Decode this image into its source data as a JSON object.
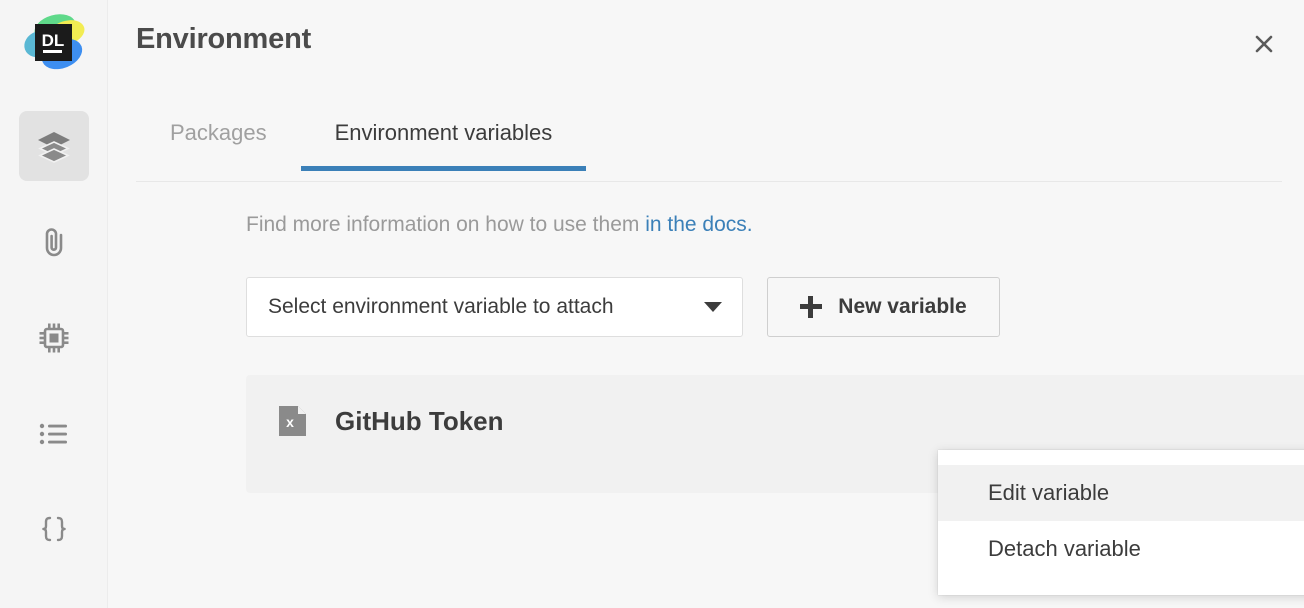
{
  "app": {
    "logo_text": "DL",
    "logo_colors": {
      "green": "#4ad18a",
      "yellow": "#f0e84a",
      "blue": "#3d8ef0",
      "teal": "#5fb7d6",
      "square": "#1b1b1b"
    }
  },
  "sidebar": {
    "items": [
      {
        "name": "environment",
        "icon": "layers-icon",
        "active": true
      },
      {
        "name": "attachments",
        "icon": "paperclip-icon",
        "active": false
      },
      {
        "name": "computation",
        "icon": "cpu-chip-icon",
        "active": false
      },
      {
        "name": "outline",
        "icon": "bulleted-list-icon",
        "active": false
      },
      {
        "name": "variables",
        "icon": "curly-braces-icon",
        "active": false
      }
    ]
  },
  "header": {
    "title": "Environment",
    "close_icon": "close-icon"
  },
  "tabs": [
    {
      "label": "Packages",
      "active": false
    },
    {
      "label": "Environment variables",
      "active": true
    }
  ],
  "docs": {
    "text": "Find more information on how to use them",
    "link_text": "in the docs."
  },
  "controls": {
    "select_label": "Select environment variable to attach",
    "select_icon": "chevron-down-icon",
    "new_variable_label": "New variable",
    "new_variable_icon": "plus-icon"
  },
  "variables": [
    {
      "name": "GitHub Token",
      "icon": "file-x-icon",
      "menu_icon": "ellipsis-icon"
    }
  ],
  "context_menu": {
    "items": [
      {
        "label": "Edit variable",
        "highlighted": true
      },
      {
        "label": "Detach variable",
        "highlighted": false
      }
    ]
  },
  "colors": {
    "accent_blue": "#3b80b8",
    "link_blue": "#3b80b8",
    "panel_bg": "#f7f7f7",
    "card_bg": "#f1f1f1",
    "sidebar_bg": "#f5f5f5",
    "text_dark": "#3c3c3c",
    "text_muted": "#9a9a9a"
  }
}
